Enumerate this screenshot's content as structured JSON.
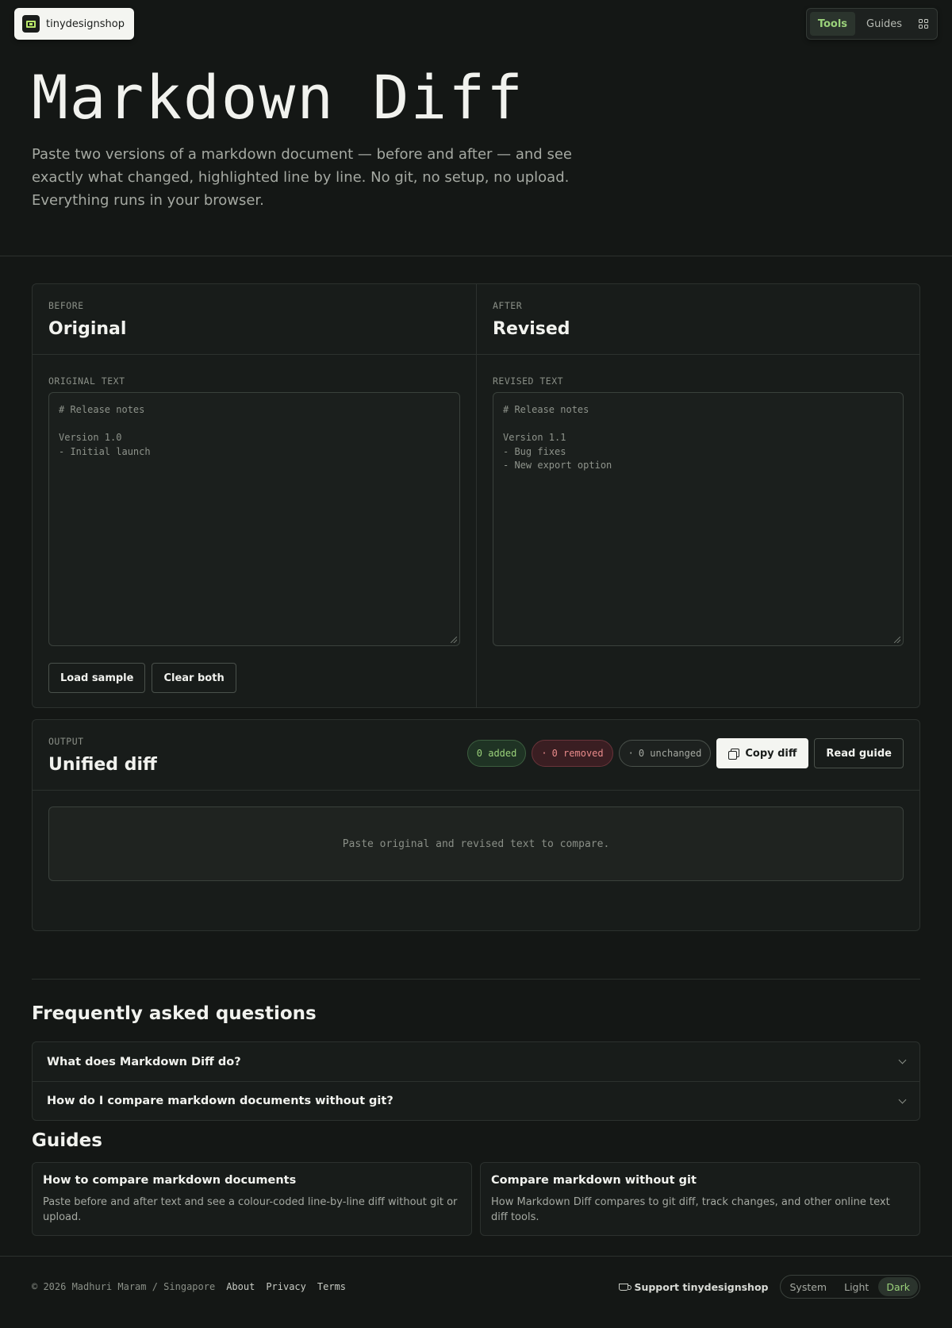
{
  "brand": {
    "name": "tinydesignshop"
  },
  "nav": {
    "tools": "Tools",
    "guides": "Guides"
  },
  "hero": {
    "title": "Markdown Diff",
    "subtitle": "Paste two versions of a markdown document — before and after — and see exactly what changed, highlighted line by line. No git, no setup, no upload. Everything runs in your browser."
  },
  "before": {
    "eyebrow": "BEFORE",
    "title": "Original",
    "field_label": "ORIGINAL TEXT",
    "placeholder": "# Release notes\n\nVersion 1.0\n- Initial launch"
  },
  "after": {
    "eyebrow": "AFTER",
    "title": "Revised",
    "field_label": "REVISED TEXT",
    "placeholder": "# Release notes\n\nVersion 1.1\n- Bug fixes\n- New export option"
  },
  "actions": {
    "load_sample": "Load sample",
    "clear_both": "Clear both"
  },
  "output": {
    "eyebrow": "OUTPUT",
    "title": "Unified diff",
    "added": "0 added",
    "removed": "0 removed",
    "unchanged": "0 unchanged",
    "copy": "Copy diff",
    "read_guide": "Read guide",
    "empty": "Paste original and revised text to compare."
  },
  "faq": {
    "heading": "Frequently asked questions",
    "items": [
      {
        "question": "What does Markdown Diff do?"
      },
      {
        "question": "How do I compare markdown documents without git?"
      }
    ]
  },
  "guides": {
    "heading": "Guides",
    "items": [
      {
        "title": "How to compare markdown documents",
        "description": "Paste before and after text and see a colour-coded line-by-line diff without git or upload."
      },
      {
        "title": "Compare markdown without git",
        "description": "How Markdown Diff compares to git diff, track changes, and other online text diff tools."
      }
    ]
  },
  "footer": {
    "copyright": "© 2026 Madhuri Maram / Singapore",
    "links": [
      "About",
      "Privacy",
      "Terms"
    ],
    "support": "Support tinydesignshop",
    "theme": {
      "options": [
        "System",
        "Light",
        "Dark"
      ],
      "selected": "Dark"
    }
  },
  "colors": {
    "accent": "#9ad17a",
    "background": "#141715",
    "removed": "#e88a8a"
  }
}
